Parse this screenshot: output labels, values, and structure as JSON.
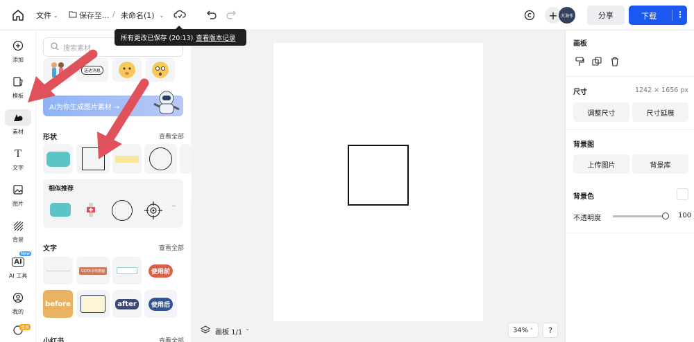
{
  "topbar": {
    "file_label": "文件",
    "save_label": "保存至...",
    "breadcrumb_sep": "/",
    "doc_name": "未命名(1)",
    "share_label": "分享",
    "download_label": "下载",
    "avatar_text": "大海作"
  },
  "tooltip": {
    "text": "所有更改已保存 (20:13)",
    "link": "查看版本记录"
  },
  "leftnav": {
    "items": [
      {
        "label": "添加",
        "icon": "plus-circle-icon"
      },
      {
        "label": "模板",
        "icon": "template-icon"
      },
      {
        "label": "素材",
        "icon": "shapes-icon"
      },
      {
        "label": "文字",
        "icon": "text-icon"
      },
      {
        "label": "图片",
        "icon": "image-icon"
      },
      {
        "label": "背景",
        "icon": "background-icon"
      },
      {
        "label": "AI 工具",
        "icon": "ai-icon"
      },
      {
        "label": "我的",
        "icon": "user-icon"
      }
    ],
    "ai_badge": "New",
    "bottom_badge": "会员"
  },
  "panel": {
    "search_placeholder": "搜索素材",
    "ai_banner": "AI为你生成图片素材 →",
    "shapes_title": "形状",
    "see_all": "查看全部",
    "similar_title": "相似推荐",
    "text_title": "文字",
    "xhs_title": "小红书",
    "sticker_text": "送达消息",
    "text_items": [
      "",
      "GOTA令你意面",
      "",
      "使用前",
      "before",
      "",
      "after",
      "使用后"
    ]
  },
  "canvas": {
    "board_label": "画板 1/1",
    "zoom": "34%",
    "help": "?"
  },
  "rightpanel": {
    "board_title": "画板",
    "size_title": "尺寸",
    "size_value": "1242 × 1656 px",
    "resize_btn": "调整尺寸",
    "extend_btn": "尺寸延展",
    "bg_image_title": "背景图",
    "upload_btn": "上传图片",
    "bg_lib_btn": "背景库",
    "bg_color_title": "背景色",
    "opacity_label": "不透明度",
    "opacity_value": "100",
    "opacity": 1.0
  },
  "colors": {
    "accent": "#1c57f0",
    "shape_teal": "#5bc4c6",
    "shape_yellow": "#f7e79a",
    "arrow": "#e0525b"
  }
}
